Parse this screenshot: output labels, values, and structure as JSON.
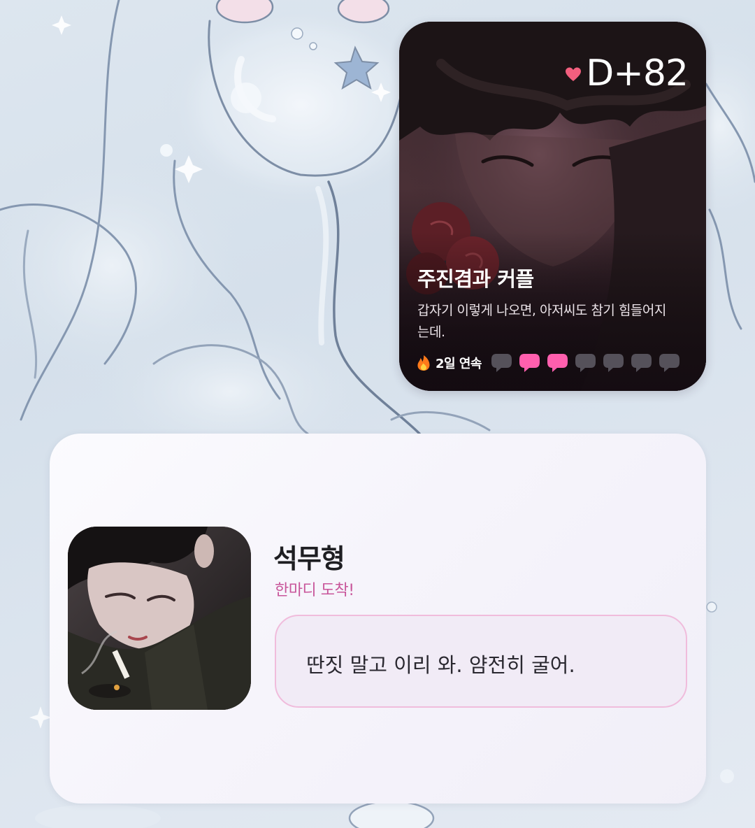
{
  "couple_widget": {
    "dday": "D+82",
    "title": "주진겸과 커플",
    "quote": "갑자기 이렇게 나오면, 아저씨도 참기 힘들어지는데.",
    "streak_label": "2일 연속",
    "bubbles": [
      "inactive",
      "active",
      "active",
      "inactive",
      "inactive",
      "inactive",
      "inactive"
    ],
    "colors": {
      "heart": "#f25f7e",
      "bubble_active": "#ff5fae",
      "bubble_inactive": "#55515a"
    }
  },
  "message_widget": {
    "name": "석무형",
    "status": "한마디 도착!",
    "message": "딴짓 말고 이리 와. 얌전히 굴어.",
    "colors": {
      "status": "#c8559a",
      "bubble_border": "#f0bcdc",
      "bubble_fill": "#f1ebf6"
    }
  },
  "icons": {
    "heart": "heart-icon",
    "fire": "fire-icon",
    "chat": "chat-bubble-icon"
  }
}
